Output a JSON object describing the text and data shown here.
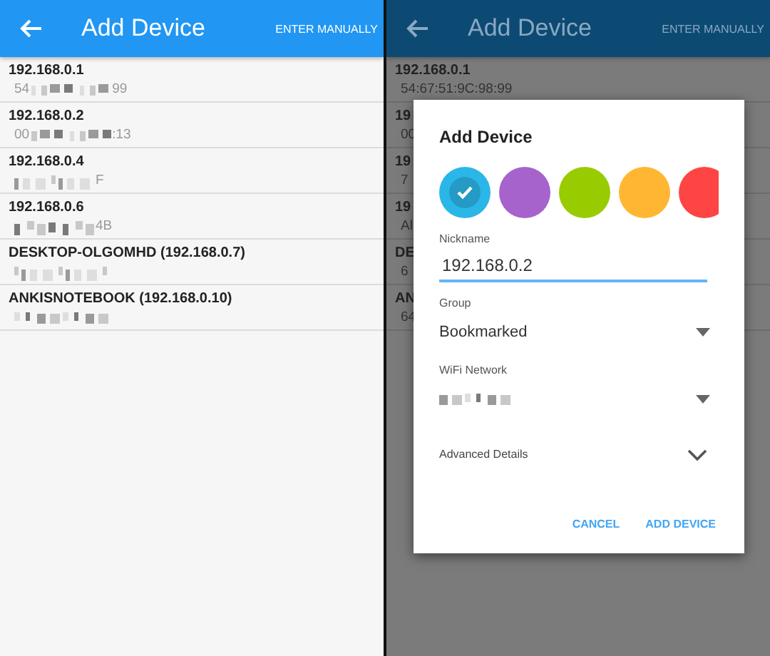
{
  "screens": [
    {
      "app_bar": {
        "title": "Add Device",
        "action": "ENTER MANUALLY"
      },
      "devices": [
        {
          "name": "192.168.0.1",
          "mac_start": "54",
          "mac_end": "99"
        },
        {
          "name": "192.168.0.2",
          "mac_start": "00",
          "mac_end": ":13"
        },
        {
          "name": "192.168.0.4",
          "mac_end": "F"
        },
        {
          "name": "192.168.0.6",
          "mac_end": "4B"
        },
        {
          "name": "DESKTOP-OLGOMHD (192.168.0.7)"
        },
        {
          "name": "ANKISNOTEBOOK (192.168.0.10)"
        }
      ]
    },
    {
      "app_bar": {
        "title": "Add Device",
        "action": "ENTER MANUALLY"
      },
      "devices": [
        {
          "name": "192.168.0.1",
          "mac_start": "54:67:51:9C:98:99"
        },
        {
          "name": "19",
          "mac_start": "00"
        },
        {
          "name": "19",
          "mac_start": "7"
        },
        {
          "name": "19",
          "mac_start": "Al"
        },
        {
          "name": "DE",
          "mac_start": "6"
        },
        {
          "name": "AN",
          "mac_start": "64"
        }
      ],
      "dialog": {
        "title": "Add Device",
        "colors": [
          {
            "color": "#2bb6e8",
            "selected": true
          },
          {
            "color": "#a663cc",
            "selected": false
          },
          {
            "color": "#99cc00",
            "selected": false
          },
          {
            "color": "#ffb733",
            "selected": false
          },
          {
            "color": "#ff4444",
            "selected": false
          }
        ],
        "nickname": {
          "label": "Nickname",
          "value": "192.168.0.2"
        },
        "group": {
          "label": "Group",
          "value": "Bookmarked"
        },
        "wifi": {
          "label": "WiFi Network"
        },
        "advanced": {
          "label": "Advanced Details",
          "expanded": false
        },
        "buttons": [
          "CANCEL",
          "ADD DEVICE"
        ]
      }
    }
  ]
}
